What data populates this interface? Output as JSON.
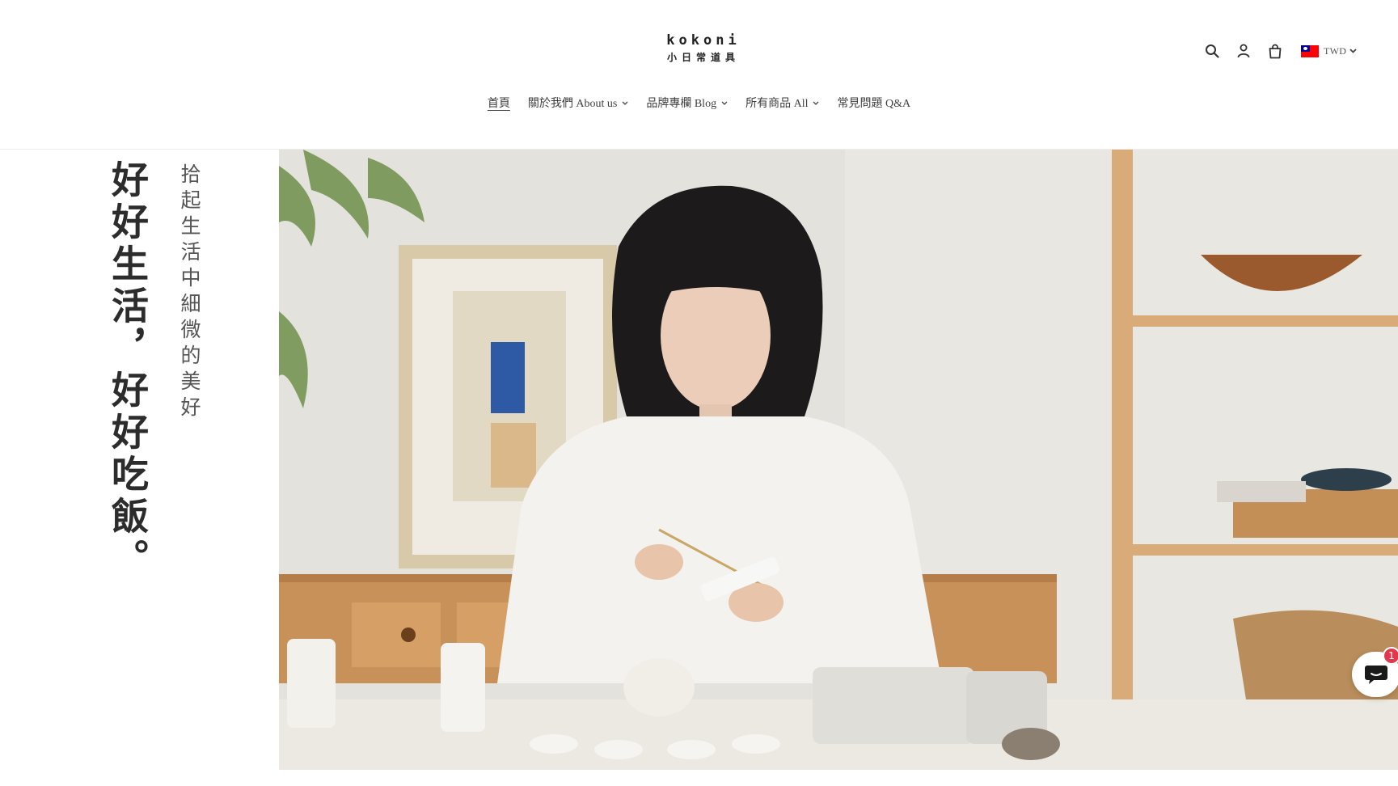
{
  "header": {
    "logo_en": "kokoni",
    "logo_zh": "小日常道具",
    "icons": [
      "search-icon",
      "account-icon",
      "cart-icon"
    ],
    "currency": {
      "code": "TWD",
      "flag": "taiwan-flag-icon"
    }
  },
  "nav": {
    "items": [
      {
        "label": "首頁",
        "active": true,
        "dropdown": false
      },
      {
        "label": "關於我們 About us",
        "active": false,
        "dropdown": true
      },
      {
        "label": "品牌專欄 Blog",
        "active": false,
        "dropdown": true
      },
      {
        "label": "所有商品 All",
        "active": false,
        "dropdown": true
      },
      {
        "label": "常見問題 Q&A",
        "active": false,
        "dropdown": false
      }
    ]
  },
  "hero": {
    "headline": "好好生活，好好吃飯。",
    "subline": "拾起生活中細微的美好",
    "image": "woman-preparing-tea-photo"
  },
  "chat": {
    "badge": "1",
    "icon": "chat-bubble-icon"
  },
  "colors": {
    "text": "#3a3a3a",
    "badge": "#e2384d",
    "divider": "#ececec"
  }
}
